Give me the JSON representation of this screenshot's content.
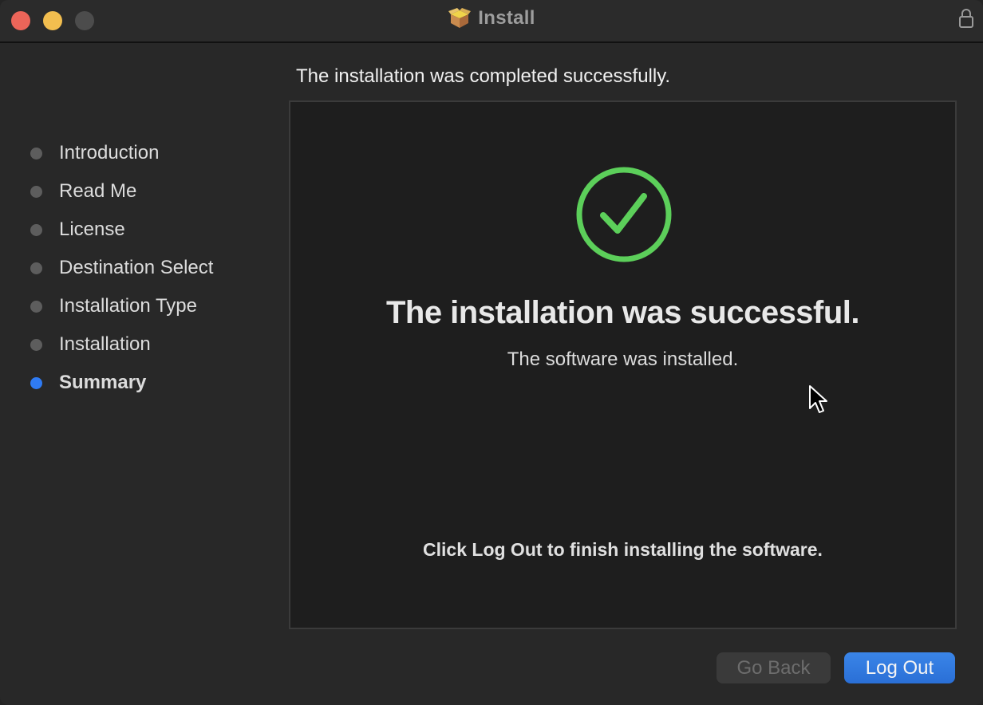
{
  "window": {
    "title": "Install",
    "title_icon": "package-icon",
    "lock_icon": "lock-icon",
    "traffic_lights": [
      "close",
      "minimize",
      "zoom"
    ]
  },
  "sidebar": {
    "steps": [
      {
        "label": "Introduction",
        "active": false
      },
      {
        "label": "Read Me",
        "active": false
      },
      {
        "label": "License",
        "active": false
      },
      {
        "label": "Destination Select",
        "active": false
      },
      {
        "label": "Installation Type",
        "active": false
      },
      {
        "label": "Installation",
        "active": false
      },
      {
        "label": "Summary",
        "active": true
      }
    ]
  },
  "main": {
    "header": "The installation was completed successfully.",
    "status_icon": "checkmark-circle-icon",
    "title": "The installation was successful.",
    "subtitle": "The software was installed.",
    "note": "Click Log Out to finish installing the software."
  },
  "buttons": {
    "go_back": "Go Back",
    "log_out": "Log Out"
  },
  "colors": {
    "success": "#5ccf5a",
    "accent": "#2f7bf4",
    "close": "#ec6559",
    "minimize": "#f2be4f"
  }
}
